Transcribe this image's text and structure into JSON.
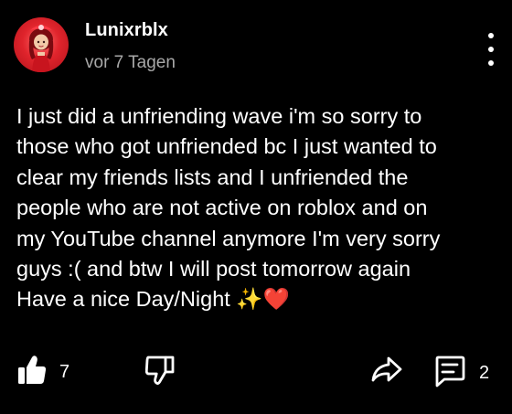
{
  "post": {
    "author": "Lunixrblx",
    "timestamp": "vor 7 Tagen",
    "body": "I just did a unfriending wave i'm so sorry to\nthose who got unfriended bc I just wanted to\nclear my friends lists and I unfriended the\npeople who are not active on roblox and on\nmy YouTube channel anymore I'm very sorry\nguys :( and btw I will post tomorrow again\nHave a nice Day/Night ✨❤️"
  },
  "actions": {
    "like_count": "7",
    "comment_count": "2"
  },
  "icons": {
    "avatar": "roblox-avatar-image",
    "more": "more-vertical-icon",
    "like": "thumbs-up-icon",
    "dislike": "thumbs-down-icon",
    "share": "share-arrow-icon",
    "comment": "comment-icon"
  },
  "colors": {
    "background": "#000000",
    "text": "#ffffff",
    "secondary_text": "#a8a8a8",
    "avatar_background": "#e0242c"
  }
}
